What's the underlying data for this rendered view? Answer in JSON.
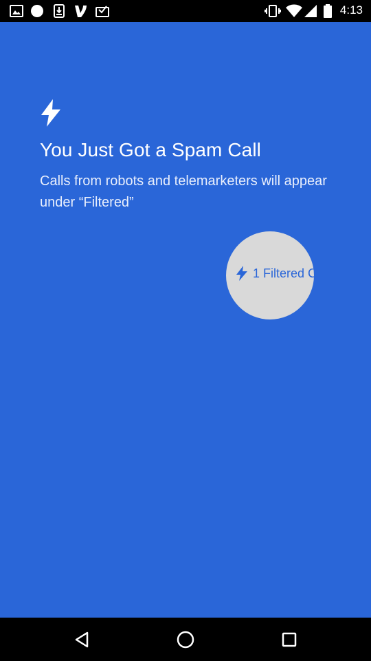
{
  "status_bar": {
    "time": "4:13",
    "left_icons": [
      "image-icon",
      "circle-icon",
      "download-icon",
      "venmo-icon",
      "inbox-check-icon"
    ],
    "right_icons": [
      "vibrate-icon",
      "wifi-icon",
      "signal-icon",
      "battery-icon"
    ]
  },
  "onboarding": {
    "icon": "bolt-icon",
    "title": "You Just Got a Spam Call",
    "subtitle": "Calls from robots and telemarketers will appear under “Filtered”"
  },
  "highlight": {
    "chip_icon": "bolt-icon",
    "chip_label": "1 Filtered C"
  },
  "nav_bar": {
    "buttons": [
      "back-icon",
      "home-icon",
      "recents-icon"
    ]
  },
  "colors": {
    "background": "#2a66d8",
    "highlight": "#d9d9d9",
    "text": "#ffffff"
  }
}
